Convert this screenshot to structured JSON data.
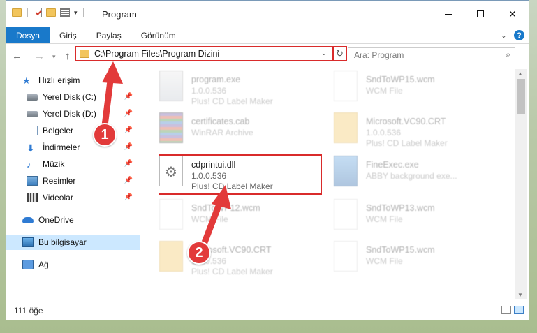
{
  "window": {
    "title": "Program",
    "controls": {
      "minimize": "—",
      "maximize": "□",
      "close": "✕"
    }
  },
  "ribbon": {
    "tabs": [
      "Dosya",
      "Giriş",
      "Paylaş",
      "Görünüm"
    ],
    "help": "?"
  },
  "address": {
    "path": "C:\\Program Files\\Program Dizini",
    "search_placeholder": "Ara: Program"
  },
  "nav_pane": {
    "quick_access": "Hızlı erişim",
    "items": [
      {
        "label": "Yerel Disk (C:)",
        "icon": "drive-icon",
        "pinned": true
      },
      {
        "label": "Yerel Disk (D:)",
        "icon": "drive-icon",
        "pinned": true
      },
      {
        "label": "Belgeler",
        "icon": "documents-icon",
        "pinned": true
      },
      {
        "label": "İndirmeler",
        "icon": "download-icon",
        "pinned": true
      },
      {
        "label": "Müzik",
        "icon": "music-icon",
        "pinned": true
      },
      {
        "label": "Resimler",
        "icon": "pictures-icon",
        "pinned": true
      },
      {
        "label": "Videolar",
        "icon": "videos-icon",
        "pinned": true
      }
    ],
    "onedrive": "OneDrive",
    "this_pc": "Bu bilgisayar",
    "network": "Ağ"
  },
  "files": [
    {
      "name": "program.exe",
      "line2": "1.0.0.536",
      "line3": "Plus! CD Label Maker",
      "icon": "exe-icon",
      "faded": true
    },
    {
      "name": "SndToWP15.wcm",
      "line2": "WCM File",
      "line3": "",
      "icon": "file-icon",
      "faded": true
    },
    {
      "name": "certificates.cab",
      "line2": "WinRAR Archive",
      "line3": "",
      "icon": "archive-icon",
      "faded": true
    },
    {
      "name": "Microsoft.VC90.CRT",
      "line2": "1.0.0.536",
      "line3": "Plus! CD Label Maker",
      "icon": "folder-icon",
      "faded": true
    },
    {
      "name": "cdprintui.dll",
      "line2": "1.0.0.536",
      "line3": "Plus! CD Label Maker",
      "icon": "dll-icon",
      "faded": false
    },
    {
      "name": "FineExec.exe",
      "line2": "ABBY background exe...",
      "line3": "",
      "icon": "exe-icon",
      "faded": true
    },
    {
      "name": "SndToWP12.wcm",
      "line2": "WCM File",
      "line3": "",
      "icon": "file-icon",
      "faded": true
    },
    {
      "name": "SndToWP13.wcm",
      "line2": "WCM File",
      "line3": "",
      "icon": "file-icon",
      "faded": true
    },
    {
      "name": "Microsoft.VC90.CRT",
      "line2": "1.0.0.536",
      "line3": "Plus! CD Label Maker",
      "icon": "folder-icon",
      "faded": true
    },
    {
      "name": "SndToWP15.wcm",
      "line2": "WCM File",
      "line3": "",
      "icon": "file-icon",
      "faded": true
    }
  ],
  "status": {
    "count": "111 öğe"
  },
  "callouts": [
    "1",
    "2"
  ],
  "colors": {
    "accent": "#1979ca",
    "highlight": "#d92b2b",
    "selection": "#cce8ff"
  }
}
